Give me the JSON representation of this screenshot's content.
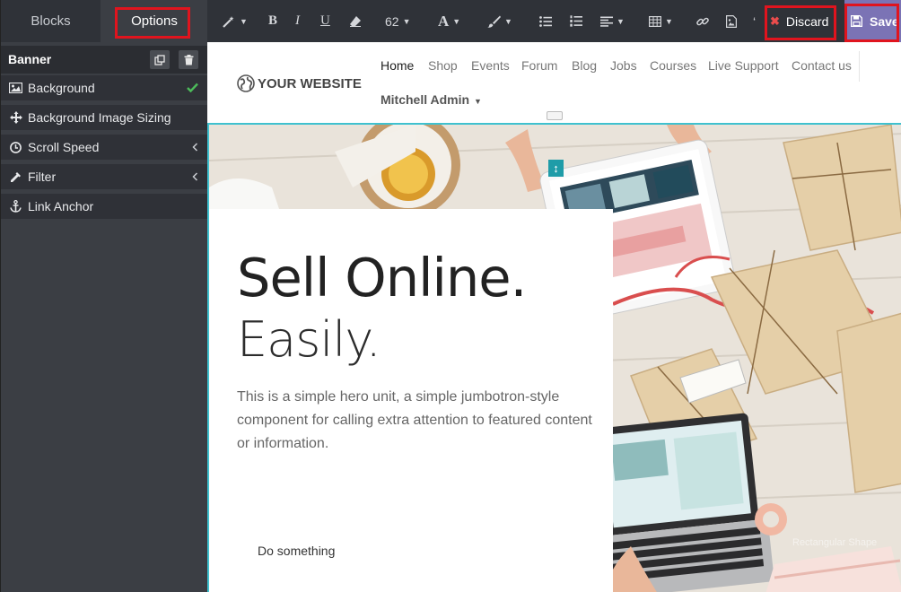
{
  "sidebar": {
    "tabs": {
      "blocks": "Blocks",
      "options": "Options"
    },
    "panel_title": "Banner",
    "options": [
      {
        "label": "Background",
        "icon": "image-icon",
        "state": "check"
      },
      {
        "label": "Background Image Sizing",
        "icon": "arrows-icon",
        "state": ""
      },
      {
        "label": "Scroll Speed",
        "icon": "clock-icon",
        "state": "chevron"
      },
      {
        "label": "Filter",
        "icon": "eyedropper-icon",
        "state": "chevron"
      },
      {
        "label": "Link Anchor",
        "icon": "anchor-icon",
        "state": ""
      }
    ]
  },
  "toolbar": {
    "font_size": "62",
    "discard_label": "Discard",
    "save_label": "Save"
  },
  "site": {
    "logo_text": "YOUR WEBSITE",
    "nav": [
      "Home",
      "Shop",
      "Events",
      "Forum",
      "Blog",
      "Jobs",
      "Courses",
      "Live Support",
      "Contact us"
    ],
    "user": "Mitchell Admin"
  },
  "hero": {
    "title_line1": "Sell Online.",
    "title_line2": "Easily.",
    "paragraph": "This is a simple hero unit, a simple jumbotron-style component for calling extra attention to featured content or information.",
    "button_label": "Do something",
    "watermark": "Rectangular Shape"
  },
  "colors": {
    "accent": "#7b73b5",
    "highlight": "#e0141e",
    "selection": "#3fc1cf",
    "check": "#4cbb5a"
  }
}
